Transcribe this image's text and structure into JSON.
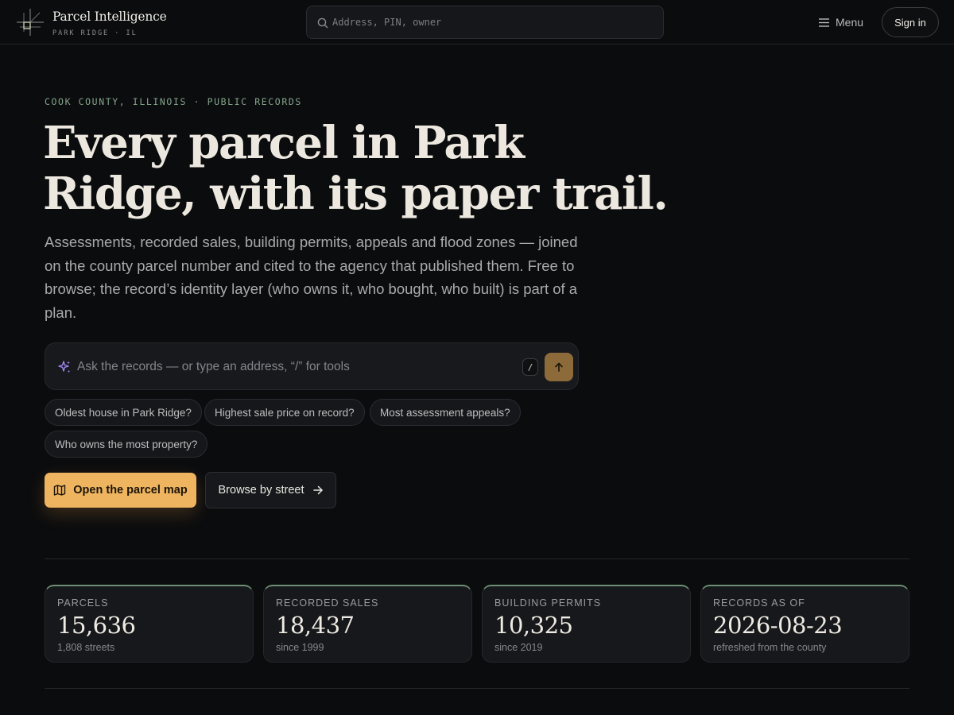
{
  "brand": {
    "name": "Parcel Intelligence",
    "location": "PARK RIDGE · IL"
  },
  "search": {
    "placeholder": "Address, PIN, owner"
  },
  "nav": {
    "menu_label": "Menu",
    "signin_label": "Sign in"
  },
  "hero": {
    "eyebrow": "COOK COUNTY, ILLINOIS · PUBLIC RECORDS",
    "headline_line1": "Every parcel in Park",
    "headline_line2": "Ridge, with its paper trail.",
    "lede": "Assessments, recorded sales, building permits, appeals and flood zones — joined on the county parcel number and cited to the agency that published them. Free to browse; the record’s identity layer (who owns it, who bought, who built) is part of a plan."
  },
  "ask": {
    "placeholder": "Ask the records — or type an address, “/” for tools",
    "shortcut_key": "/"
  },
  "suggestions": [
    "Oldest house in Park Ridge?",
    "Highest sale price on record?",
    "Most assessment appeals?",
    "Who owns the most property?"
  ],
  "actions": {
    "primary_label": "Open the parcel map",
    "secondary_label": "Browse by street"
  },
  "stats": [
    {
      "label": "PARCELS",
      "value": "15,636",
      "sub": "1,808 streets"
    },
    {
      "label": "RECORDED SALES",
      "value": "18,437",
      "sub": "since 1999"
    },
    {
      "label": "BUILDING PERMITS",
      "value": "10,325",
      "sub": "since 2019"
    },
    {
      "label": "RECORDS AS OF",
      "value": "2026-08-23",
      "sub": "refreshed from the county"
    }
  ],
  "colors": {
    "background": "#0b0c0e",
    "accent_gold": "#eeb460",
    "accent_green": "#84a48b",
    "sparkle_purple": "#a78bfa"
  },
  "icons": {
    "logo": "crosshair-parcel-logo",
    "search": "magnifier-icon",
    "menu": "hamburger-icon",
    "ask": "sparkle-icon",
    "submit": "arrow-up-icon",
    "primary": "map-icon",
    "secondary": "arrow-right-icon"
  }
}
